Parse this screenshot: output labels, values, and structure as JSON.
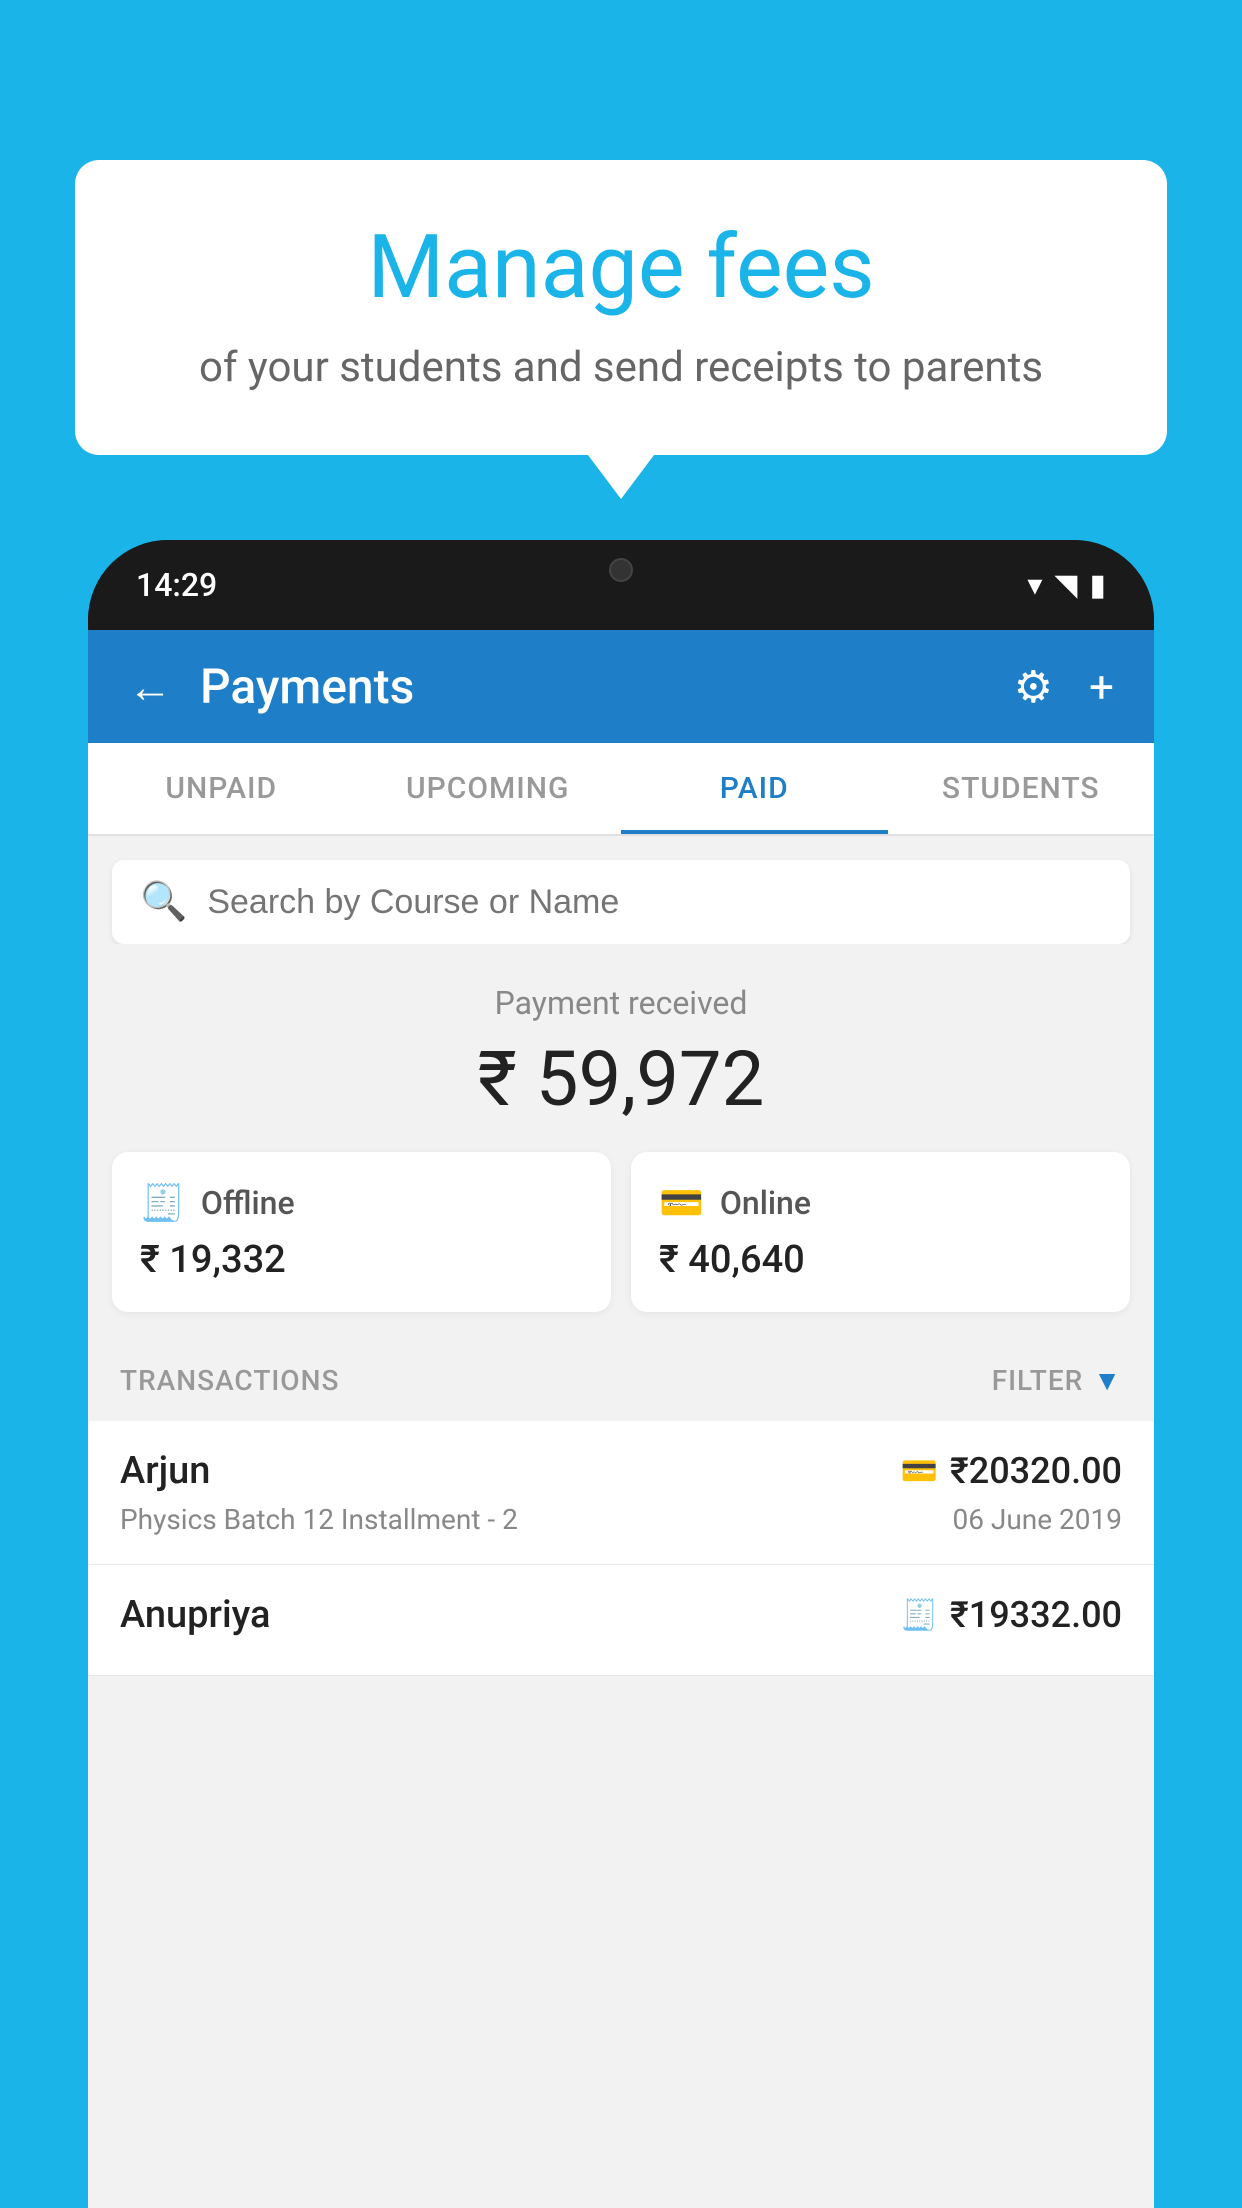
{
  "background_color": "#1ab4e8",
  "speech_bubble": {
    "title": "Manage fees",
    "subtitle": "of your students and send receipts to parents"
  },
  "phone": {
    "time": "14:29",
    "header": {
      "title": "Payments",
      "back_label": "←",
      "gear_label": "⚙",
      "plus_label": "+"
    },
    "tabs": [
      {
        "id": "unpaid",
        "label": "UNPAID",
        "active": false
      },
      {
        "id": "upcoming",
        "label": "UPCOMING",
        "active": false
      },
      {
        "id": "paid",
        "label": "PAID",
        "active": true
      },
      {
        "id": "students",
        "label": "STUDENTS",
        "active": false
      }
    ],
    "search": {
      "placeholder": "Search by Course or Name"
    },
    "payment_summary": {
      "label": "Payment received",
      "amount": "₹ 59,972"
    },
    "payment_cards": [
      {
        "id": "offline",
        "icon": "💳",
        "type": "Offline",
        "amount": "₹ 19,332"
      },
      {
        "id": "online",
        "icon": "💳",
        "type": "Online",
        "amount": "₹ 40,640"
      }
    ],
    "transactions_label": "TRANSACTIONS",
    "filter_label": "FILTER",
    "transactions": [
      {
        "name": "Arjun",
        "amount": "₹20320.00",
        "description": "Physics Batch 12 Installment - 2",
        "date": "06 June 2019",
        "payment_type": "online"
      },
      {
        "name": "Anupriya",
        "amount": "₹19332.00",
        "description": "",
        "date": "",
        "payment_type": "offline"
      }
    ]
  }
}
